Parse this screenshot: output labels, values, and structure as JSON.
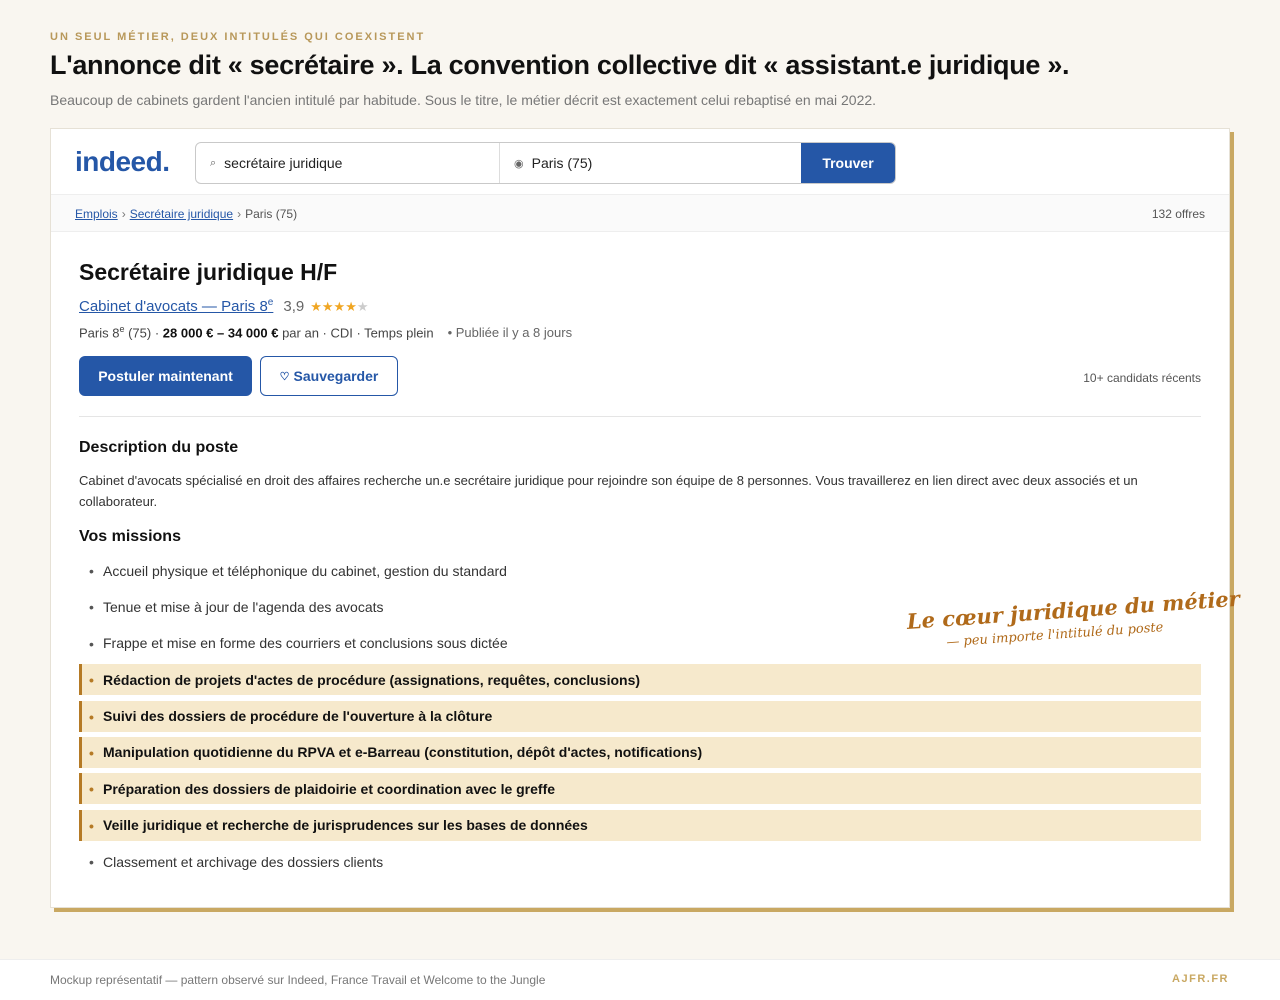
{
  "header": {
    "eyebrow": "UN SEUL MÉTIER, DEUX INTITULÉS QUI COEXISTENT",
    "headline": "L'annonce dit « secrétaire ». La convention collective dit « assistant.e juridique ».",
    "subline": "Beaucoup de cabinets gardent l'ancien intitulé par habitude. Sous le titre, le métier décrit est exactement celui rebaptisé en mai 2022."
  },
  "indeed": {
    "logo": "indeed",
    "search_value": "secrétaire juridique",
    "location_value": "Paris (75)",
    "find_label": "Trouver",
    "breadcrumb": [
      "Emplois",
      "Secrétaire juridique",
      "Paris (75)"
    ],
    "offers_count": "132 offres"
  },
  "job": {
    "title": "Secrétaire juridique H/F",
    "company": "Cabinet d'avocats — Paris 8",
    "company_sup": "e",
    "rating": "3,9",
    "stars_filled": 4,
    "stars_total": 5,
    "meta_location": "Paris 8",
    "meta_location_sup": "e",
    "meta_location_suffix": " (75) · ",
    "salary": "28 000 € – 34 000 €",
    "meta_rest": " par an · CDI · Temps plein",
    "posted": "• Publiée il y a 8 jours",
    "apply_label": "Postuler maintenant",
    "save_label": "Sauvegarder",
    "candidates": "10+ candidats récents",
    "description_title": "Description du poste",
    "description_text": "Cabinet d'avocats spécialisé en droit des affaires recherche un.e secrétaire juridique pour rejoindre son équipe de 8 personnes. Vous travaillerez en lien direct avec deux associés et un collaborateur.",
    "missions_title": "Vos missions",
    "missions": [
      {
        "text": "Accueil physique et téléphonique du cabinet, gestion du standard",
        "highlight": false
      },
      {
        "text": "Tenue et mise à jour de l'agenda des avocats",
        "highlight": false
      },
      {
        "text": "Frappe et mise en forme des courriers et conclusions sous dictée",
        "highlight": false
      },
      {
        "text": "Rédaction de projets d'actes de procédure (assignations, requêtes, conclusions)",
        "highlight": true
      },
      {
        "text": "Suivi des dossiers de procédure de l'ouverture à la clôture",
        "highlight": true
      },
      {
        "text": "Manipulation quotidienne du RPVA et e-Barreau (constitution, dépôt d'actes, notifications)",
        "highlight": true
      },
      {
        "text": "Préparation des dossiers de plaidoirie et coordination avec le greffe",
        "highlight": true
      },
      {
        "text": "Veille juridique et recherche de jurisprudences sur les bases de données",
        "highlight": true
      },
      {
        "text": "Classement et archivage des dossiers clients",
        "highlight": false
      }
    ]
  },
  "annotation": {
    "main": "Le cœur juridique du métier",
    "sub": "— peu importe l'intitulé du poste"
  },
  "footer": {
    "note": "Mockup représentatif — pattern observé sur Indeed, France Travail et Welcome to the Jungle",
    "brand": "AJFR.FR"
  },
  "colors": {
    "indeed_blue": "#2557a7",
    "gold": "#c9a862",
    "highlight_bg": "#f6e9cc",
    "highlight_border": "#b57a25"
  }
}
